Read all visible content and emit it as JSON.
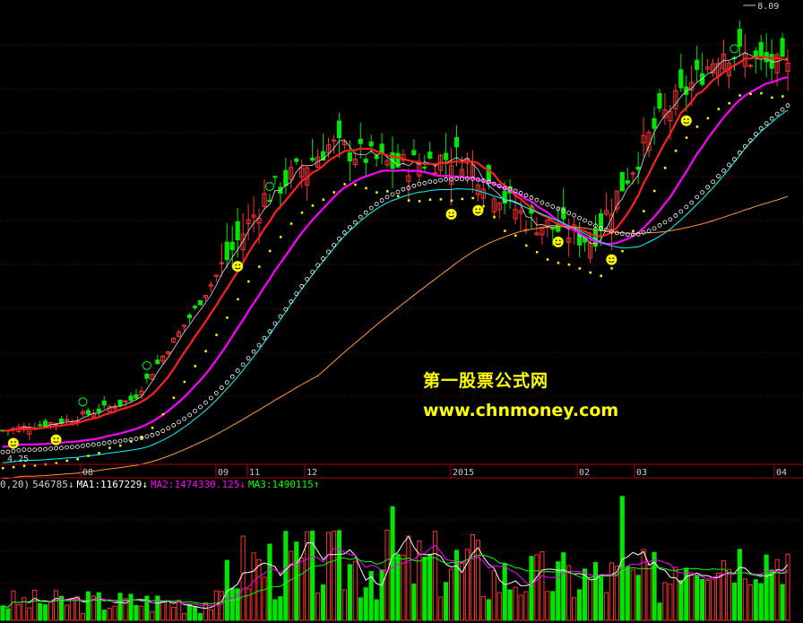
{
  "watermark": {
    "title": "第一股票公式网",
    "url": "www.chnmoney.com"
  },
  "price_labels": {
    "high": "8.09",
    "low": "4.25"
  },
  "x_axis_labels": [
    "08",
    "09",
    "11",
    "12",
    "2015",
    "02",
    "03",
    "04"
  ],
  "volume_indicator": {
    "prefix": "0,20)",
    "vol": "546785",
    "vol_arrow": "↓",
    "ma1_label": "MA1:1167229",
    "ma1_arrow": "↓",
    "ma2_label": "MA2:1474330.125",
    "ma2_arrow": "↓",
    "ma3_label": "MA3:1490115",
    "ma3_arrow": "↑"
  },
  "colors": {
    "up": "#ff3232",
    "down": "#00e600",
    "ma_red": "#ff2020",
    "ma_magenta": "#ff00ff",
    "ma_cyan": "#00ffff",
    "ma_orange": "#ff9933",
    "dots_yellow": "#ffff00",
    "grid": "#8b0000",
    "axis": "#b00000",
    "text": "#cccccc",
    "ma1": "#ffffff",
    "ma2": "#ff00ff",
    "ma3": "#00ff00"
  },
  "chart_data": {
    "type": "candlestick",
    "price_range": [
      4.0,
      8.3
    ],
    "high": 8.09,
    "low": 4.25,
    "key_closes": [
      4.3,
      4.4,
      4.6,
      5.5,
      6.5,
      7.0,
      6.8,
      6.9,
      6.3,
      6.1,
      7.2,
      7.9,
      7.7
    ],
    "volume_range": [
      0,
      2500000
    ]
  }
}
